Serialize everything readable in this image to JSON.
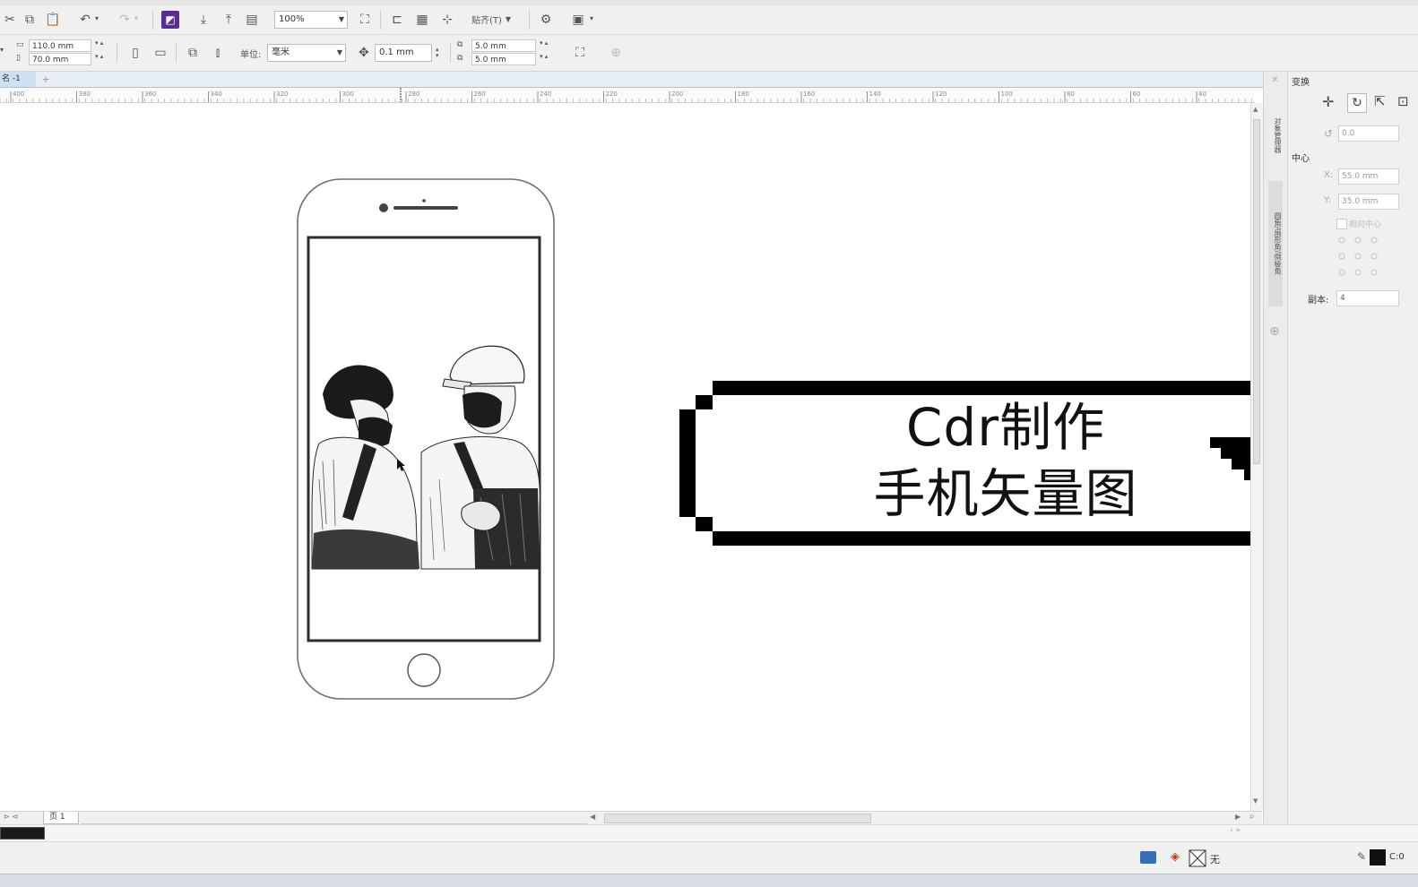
{
  "toolbar": {
    "zoom": "100%",
    "snap_label": "贴齐(T)"
  },
  "props": {
    "width": "110.0 mm",
    "height": "70.0 mm",
    "units_label": "单位:",
    "units_value": "毫米",
    "nudge": "0.1 mm",
    "dup_x": "5.0 mm",
    "dup_y": "5.0 mm"
  },
  "document": {
    "tab_label": "名 -1"
  },
  "ruler": {
    "ticks": [
      "400",
      "380",
      "360",
      "340",
      "320",
      "300",
      "280",
      "260",
      "240",
      "220",
      "200",
      "180",
      "160",
      "140",
      "120",
      "100",
      "80",
      "60",
      "40",
      "20"
    ]
  },
  "banner": {
    "line1": "Cdr制作",
    "line2": "手机矢量图"
  },
  "docker": {
    "title": "变换",
    "rotation": "0.0",
    "center_label": "中心",
    "x_label": "X:",
    "x_value": "55.0 mm",
    "y_label": "Y:",
    "y_value": "35.0 mm",
    "relative_center": "相对中心",
    "copies_label": "副本:",
    "copies_value": "4",
    "side_tab_1": "对象管理器",
    "side_tab_2": "圆角/扇形角/倒棱角"
  },
  "pages": {
    "page_tab": "页 1"
  },
  "status": {
    "fill_none": "无",
    "color_readout": "C:0"
  },
  "colors": {
    "ruler_line": "#9cc3e8",
    "canvas": "#ffffff",
    "ui_gray": "#f0f0f0",
    "ink": "#111111"
  }
}
